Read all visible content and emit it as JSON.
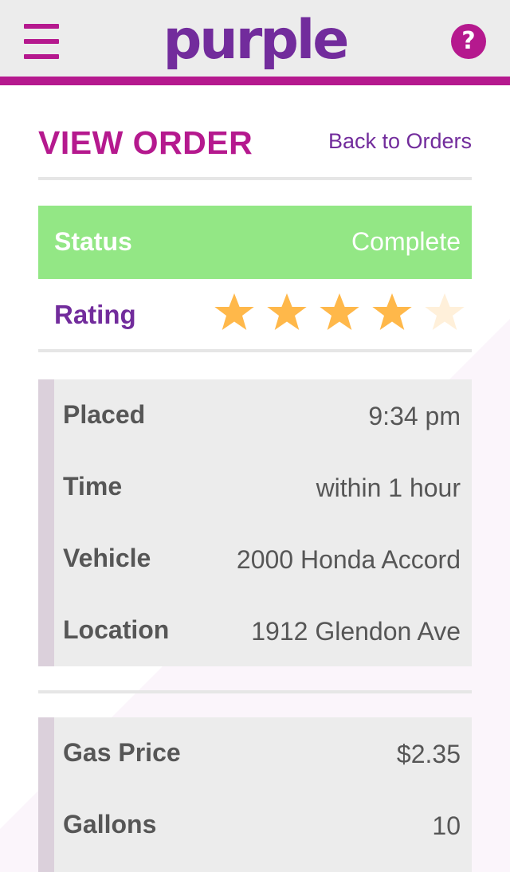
{
  "header": {
    "logo_text": "purple",
    "help_label": "?",
    "menu_icon": "hamburger-menu-icon",
    "help_icon": "question-circle-icon"
  },
  "page": {
    "title": "VIEW ORDER",
    "back_link": "Back to Orders"
  },
  "status": {
    "label": "Status",
    "value": "Complete",
    "color": "#93e785"
  },
  "rating": {
    "label": "Rating",
    "value": 4,
    "max": 5,
    "star_color": "#ffb84a",
    "empty_star_color": "#fff0da"
  },
  "order_details": [
    {
      "label": "Placed",
      "value": "9:34 pm"
    },
    {
      "label": "Time",
      "value": "within 1 hour"
    },
    {
      "label": "Vehicle",
      "value": "2000 Honda Accord"
    },
    {
      "label": "Location",
      "value": "1912 Glendon Ave"
    }
  ],
  "pricing": [
    {
      "label": "Gas Price",
      "value": "$2.35"
    },
    {
      "label": "Gallons",
      "value": "10"
    }
  ],
  "colors": {
    "brand_purple": "#722c9c",
    "brand_magenta": "#b5198e",
    "card_bg": "#ececec",
    "card_accent": "#dbd0db",
    "text_gray": "#565656"
  }
}
